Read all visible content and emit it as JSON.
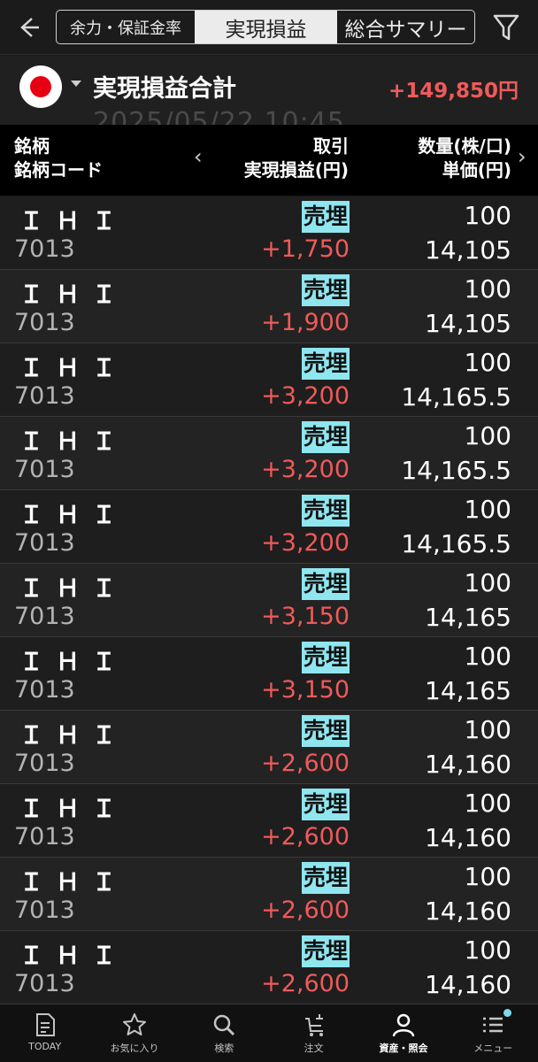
{
  "tabs": [
    "余力・保証金率",
    "実現損益",
    "総合サマリー"
  ],
  "summary": {
    "title": "実現損益合計",
    "total": "+149,850円",
    "date_partial": "2025/05/22 10:45"
  },
  "columns": {
    "name": "銘柄",
    "code": "銘柄コード",
    "trade": "取引",
    "pl": "実現損益(円)",
    "qty": "数量(株/口)",
    "price": "単価(円)"
  },
  "rows": [
    {
      "name": "ＩＨＩ",
      "code": "7013",
      "type": "売埋",
      "pl": "+1,750",
      "qty": "100",
      "price": "14,105"
    },
    {
      "name": "ＩＨＩ",
      "code": "7013",
      "type": "売埋",
      "pl": "+1,900",
      "qty": "100",
      "price": "14,105"
    },
    {
      "name": "ＩＨＩ",
      "code": "7013",
      "type": "売埋",
      "pl": "+3,200",
      "qty": "100",
      "price": "14,165.5"
    },
    {
      "name": "ＩＨＩ",
      "code": "7013",
      "type": "売埋",
      "pl": "+3,200",
      "qty": "100",
      "price": "14,165.5"
    },
    {
      "name": "ＩＨＩ",
      "code": "7013",
      "type": "売埋",
      "pl": "+3,200",
      "qty": "100",
      "price": "14,165.5"
    },
    {
      "name": "ＩＨＩ",
      "code": "7013",
      "type": "売埋",
      "pl": "+3,150",
      "qty": "100",
      "price": "14,165"
    },
    {
      "name": "ＩＨＩ",
      "code": "7013",
      "type": "売埋",
      "pl": "+3,150",
      "qty": "100",
      "price": "14,165"
    },
    {
      "name": "ＩＨＩ",
      "code": "7013",
      "type": "売埋",
      "pl": "+2,600",
      "qty": "100",
      "price": "14,160"
    },
    {
      "name": "ＩＨＩ",
      "code": "7013",
      "type": "売埋",
      "pl": "+2,600",
      "qty": "100",
      "price": "14,160"
    },
    {
      "name": "ＩＨＩ",
      "code": "7013",
      "type": "売埋",
      "pl": "+2,600",
      "qty": "100",
      "price": "14,160"
    },
    {
      "name": "ＩＨＩ",
      "code": "7013",
      "type": "売埋",
      "pl": "+2,600",
      "qty": "100",
      "price": "14,160"
    }
  ],
  "bottom_nav": [
    {
      "label": "TODAY",
      "icon": "today-icon"
    },
    {
      "label": "お気に入り",
      "icon": "star-icon"
    },
    {
      "label": "検索",
      "icon": "search-icon"
    },
    {
      "label": "注文",
      "icon": "cart-icon"
    },
    {
      "label": "資産・照会",
      "icon": "person-icon"
    },
    {
      "label": "メニュー",
      "icon": "menu-icon"
    }
  ],
  "colors": {
    "positive": "#f05a5a",
    "trade_badge": "#8fe6ef",
    "background": "#1a1a1a"
  }
}
